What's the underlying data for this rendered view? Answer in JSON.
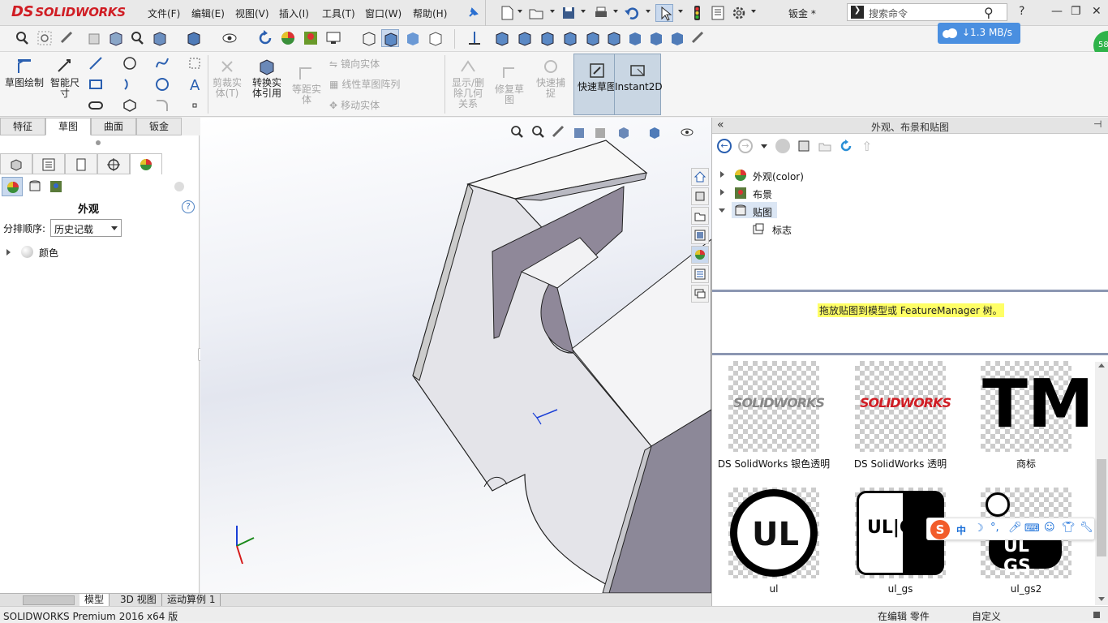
{
  "app": {
    "logo_text": "SOLIDWORKS",
    "logo_prefix": "DS",
    "doc_title": "钣金 *",
    "brand_color": "#d01d24"
  },
  "menu": [
    "文件(F)",
    "编辑(E)",
    "视图(V)",
    "插入(I)",
    "工具(T)",
    "窗口(W)",
    "帮助(H)"
  ],
  "search": {
    "placeholder": "搜索命令"
  },
  "network": {
    "speed": "↓1.3 MB/s"
  },
  "badge": {
    "value": "58"
  },
  "commands": {
    "sketch": "草图绘制",
    "smart_dim": "智能尺寸",
    "trim": "剪裁实体(T)",
    "convert": "转换实体引用",
    "offset": "等距实体",
    "mirror": "镜向实体",
    "linear_pattern": "线性草图阵列",
    "move": "移动实体",
    "show_relations": "显示/删除几何关系",
    "repair": "修复草图",
    "quick_snap": "快速捕捉",
    "rapid_sketch": "快速草图",
    "instant2d": "Instant2D"
  },
  "cmd_tabs": [
    "特征",
    "草图",
    "曲面",
    "钣金"
  ],
  "cmd_tab_active": 1,
  "left_panel": {
    "title": "外观",
    "sort_label": "分排顺序:",
    "sort_value": "历史记载",
    "color_item": "颜色"
  },
  "right_panel": {
    "title": "外观、布景和贴图",
    "tree": [
      {
        "label": "外观(color)",
        "icon": "appearance-ball-icon",
        "expanded": false
      },
      {
        "label": "布景",
        "icon": "scene-icon",
        "expanded": false
      },
      {
        "label": "贴图",
        "icon": "decal-icon",
        "expanded": true
      }
    ],
    "subitem": "标志",
    "hint": "拖放贴图到模型或 FeatureManager 树。",
    "thumbnails": [
      {
        "caption": "DS SolidWorks 银色透明",
        "art": "SOLIDWORKS",
        "color": "#888888"
      },
      {
        "caption": "DS SolidWorks 透明",
        "art": "SOLIDWORKS",
        "color": "#d01d24"
      },
      {
        "caption": "商标",
        "art": "TM",
        "color": "#000000"
      },
      {
        "caption": "ul",
        "art": "UL",
        "color": "#000000"
      },
      {
        "caption": "ul_gs",
        "art": "UL|GS",
        "color": "#000000"
      },
      {
        "caption": "ul_gs2",
        "art": "UL GS",
        "color": "#000000"
      }
    ]
  },
  "bottom_tabs": [
    "模型",
    "3D 视图",
    "运动算例 1"
  ],
  "status": {
    "left": "SOLIDWORKS Premium 2016 x64 版",
    "mode": "在编辑 零件",
    "units": "自定义"
  },
  "ime": {
    "label": "中"
  }
}
